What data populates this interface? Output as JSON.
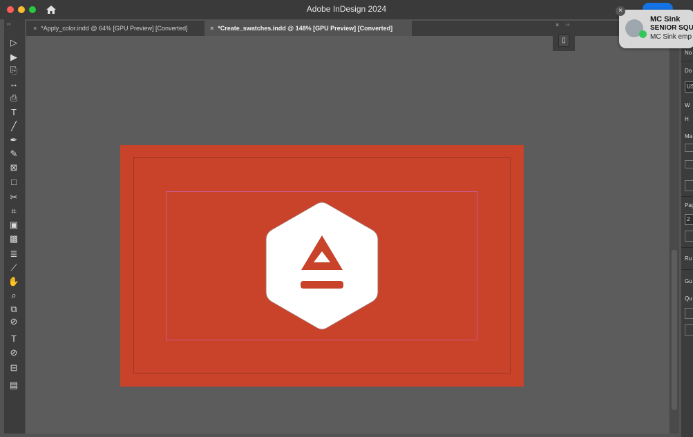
{
  "app": {
    "title": "Adobe InDesign 2024"
  },
  "tabs": [
    {
      "label": "*Apply_color.indd @ 64% [GPU Preview] [Converted]",
      "close": "×"
    },
    {
      "label": "*Create_swatches.indd @ 148% [GPU Preview] [Converted]",
      "close": "×"
    }
  ],
  "toolbar": {
    "tools": [
      {
        "name": "selection-tool",
        "glyph": "▷"
      },
      {
        "name": "direct-selection-tool",
        "glyph": "▶"
      },
      {
        "name": "page-tool",
        "glyph": "⎘"
      },
      {
        "name": "gap-tool",
        "glyph": "↔"
      },
      {
        "name": "content-collector-tool",
        "glyph": "⎙"
      },
      {
        "name": "type-tool",
        "glyph": "T"
      },
      {
        "name": "line-tool",
        "glyph": "╱"
      },
      {
        "name": "pen-tool",
        "glyph": "✒"
      },
      {
        "name": "pencil-tool",
        "glyph": "✎"
      },
      {
        "name": "rectangle-frame-tool",
        "glyph": "⊠"
      },
      {
        "name": "rectangle-tool",
        "glyph": "□"
      },
      {
        "name": "scissors-tool",
        "glyph": "✂"
      },
      {
        "name": "free-transform-tool",
        "glyph": "⌗"
      },
      {
        "name": "gradient-swatch-tool",
        "glyph": "▣"
      },
      {
        "name": "gradient-feather-tool",
        "glyph": "▩"
      },
      {
        "name": "note-tool",
        "glyph": "≣"
      },
      {
        "name": "eyedropper-tool",
        "glyph": "⟋"
      },
      {
        "name": "hand-tool",
        "glyph": "✋"
      },
      {
        "name": "zoom-tool",
        "glyph": "⌕"
      },
      {
        "name": "default-fill-stroke",
        "glyph": "⧉"
      },
      {
        "name": "fill-stroke",
        "glyph": "⊘"
      },
      {
        "name": "formatting-affects",
        "glyph": "T"
      },
      {
        "name": "apply-none",
        "glyph": "⊘"
      },
      {
        "name": "view-mode",
        "glyph": "⊟"
      },
      {
        "name": "screen-mode",
        "glyph": "▤"
      }
    ]
  },
  "float_panel": {
    "close": "×",
    "grip": "››",
    "button": "▯"
  },
  "notification": {
    "title": "MC Sink",
    "subtitle": "SENIOR SQU",
    "body": "MC Sink emp",
    "close": "×"
  },
  "properties": {
    "labels": [
      "No",
      "Do",
      "US",
      "W",
      "H",
      "Ma",
      "Pag",
      "2",
      "Ru",
      "Gu",
      "Qu"
    ]
  },
  "colors": {
    "document_fill": "#c9422a",
    "guide_magenta": "#cc5a88",
    "logo_white": "#ffffff"
  }
}
